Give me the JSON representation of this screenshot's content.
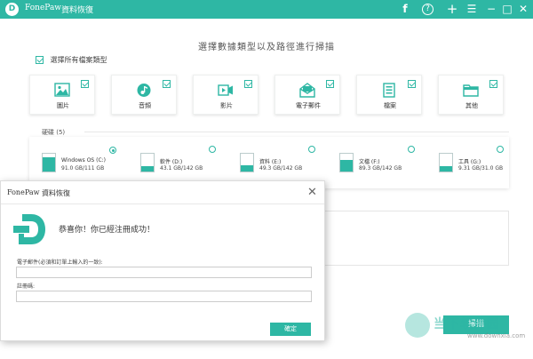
{
  "titlebar": {
    "app_name": "FonePaw",
    "product_name": "資料恢復",
    "controls": [
      "f",
      "?",
      "+",
      "☰",
      "−",
      "□",
      "✕"
    ]
  },
  "main": {
    "title": "選擇數據類型以及路徑進行掃描",
    "select_all_label": "選擇所有檔案類型",
    "file_types": [
      {
        "label": "圖片",
        "icon": "image-icon"
      },
      {
        "label": "音頻",
        "icon": "music-icon"
      },
      {
        "label": "影片",
        "icon": "video-icon"
      },
      {
        "label": "電子郵件",
        "icon": "email-icon"
      },
      {
        "label": "檔案",
        "icon": "document-icon"
      },
      {
        "label": "其他",
        "icon": "folder-icon"
      }
    ],
    "drives_header": "硬碟 (5)",
    "drives": [
      {
        "name": "Windows OS (C:)",
        "size": "91.0 GB/111 GB",
        "used_fraction": 0.82,
        "selected": true
      },
      {
        "name": "軟件 (D:)",
        "size": "43.1 GB/142 GB",
        "used_fraction": 0.3,
        "selected": false
      },
      {
        "name": "資料 (E:)",
        "size": "49.3 GB/142 GB",
        "used_fraction": 0.35,
        "selected": false
      },
      {
        "name": "文檔 (F:)",
        "size": "89.3 GB/142 GB",
        "used_fraction": 0.63,
        "selected": false
      },
      {
        "name": "工具 (G:)",
        "size": "9.31 GB/31.0 GB",
        "used_fraction": 0.3,
        "selected": false
      }
    ],
    "scan_button": "掃描"
  },
  "dialog": {
    "app_name": "FonePaw",
    "product_name": "資料恢復",
    "message": "恭喜你！你已經注冊成功！",
    "email_label": "電子郵件(必須和訂單上輸入的一致):",
    "email_value": "",
    "code_label": "註冊碼:",
    "code_value": "",
    "ok_button": "確定"
  },
  "watermark": {
    "text": "当下软件园",
    "url": "www.downxia.com"
  },
  "colors": {
    "accent": "#2eb7a4"
  }
}
